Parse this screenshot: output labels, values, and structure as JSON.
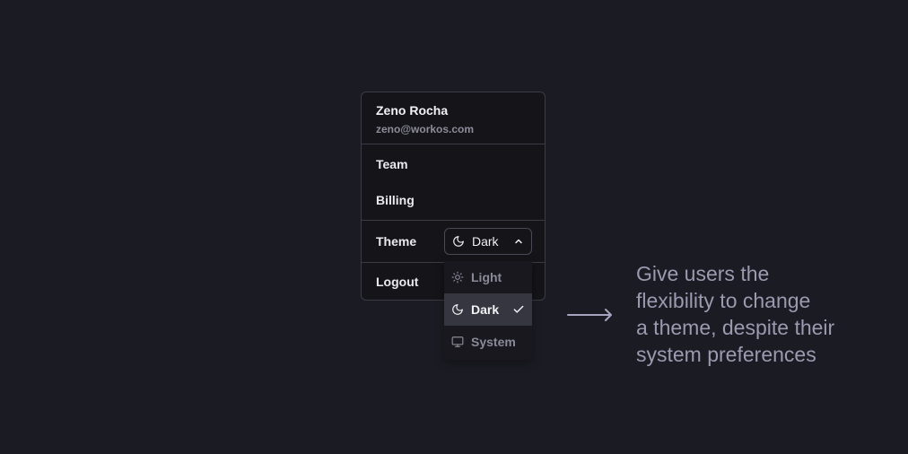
{
  "menu": {
    "user": {
      "name": "Zeno Rocha",
      "email": "zeno@workos.com"
    },
    "items": [
      {
        "label": "Team"
      },
      {
        "label": "Billing"
      }
    ],
    "theme": {
      "label": "Theme",
      "selected": "Dark",
      "selected_icon": "moon-icon",
      "expanded_icon": "chevron-up-icon",
      "options": [
        {
          "label": "Light",
          "icon": "sun-icon",
          "active": false
        },
        {
          "label": "Dark",
          "icon": "moon-icon",
          "active": true
        },
        {
          "label": "System",
          "icon": "monitor-icon",
          "active": false
        }
      ]
    },
    "logout": "Logout"
  },
  "annotation": {
    "arrow_icon": "arrow-right-icon",
    "lines": [
      "Give users the",
      "flexibility to change",
      "a theme, despite their",
      "system preferences"
    ]
  },
  "colors": {
    "background": "#1b1b23",
    "menu_bg": "#141419",
    "border": "#3b3b46",
    "active_option_bg": "#363640",
    "caption": "#9a9ab0"
  }
}
